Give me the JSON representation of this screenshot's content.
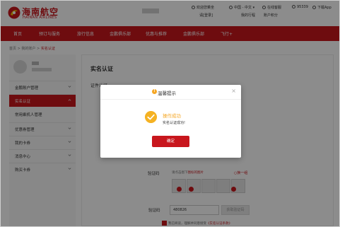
{
  "header": {
    "brand_cn": "海南航空",
    "brand_en": "HAINAN AIRLINES",
    "welcome": "欢迎您乘坐",
    "login_link": "请[登录]",
    "language": "中国 - 中文",
    "online_service": "在线客服",
    "phone": "95339",
    "download_app": "下载App",
    "row2_a": "我的行程",
    "row2_b": "账户积分"
  },
  "nav": {
    "items": [
      "首页",
      "预订与服务",
      "旅行信息",
      "金鹏俱乐部",
      "优惠与推荐",
      "金鹏俱乐部",
      "飞行+"
    ]
  },
  "breadcrumb": {
    "home": "首页",
    "sep1": ">",
    "account": "我的账户",
    "sep2": ">",
    "current": "实名认证"
  },
  "sidebar": {
    "items": [
      {
        "label": "金鹏账户管理"
      },
      {
        "label": "实名认证"
      },
      {
        "label": "常用乘机人管理"
      },
      {
        "label": "优惠券管理"
      },
      {
        "label": "我的卡券"
      },
      {
        "label": "消息中心"
      },
      {
        "label": "购买卡券"
      }
    ]
  },
  "main": {
    "title": "实名认证",
    "subtitle": "证件认证",
    "captcha_label": "验证码",
    "captcha_hint_a": "请点击图下",
    "captcha_hint_b": "图标的图片",
    "captcha_refresh": "换一组",
    "sms_label": "验证码",
    "sms_value": "480826",
    "sms_button": "获取验证码",
    "agree_prefix": "我已阅读，理解并同意接受",
    "agree_link": "《实名认证条款》"
  },
  "modal": {
    "title": "温馨提示",
    "close": "×",
    "success_title": "操作成功",
    "success_msg": "实名认证成功!",
    "confirm": "确定"
  },
  "colors": {
    "brand_red": "#c8161d",
    "success_orange": "#f5a623"
  }
}
